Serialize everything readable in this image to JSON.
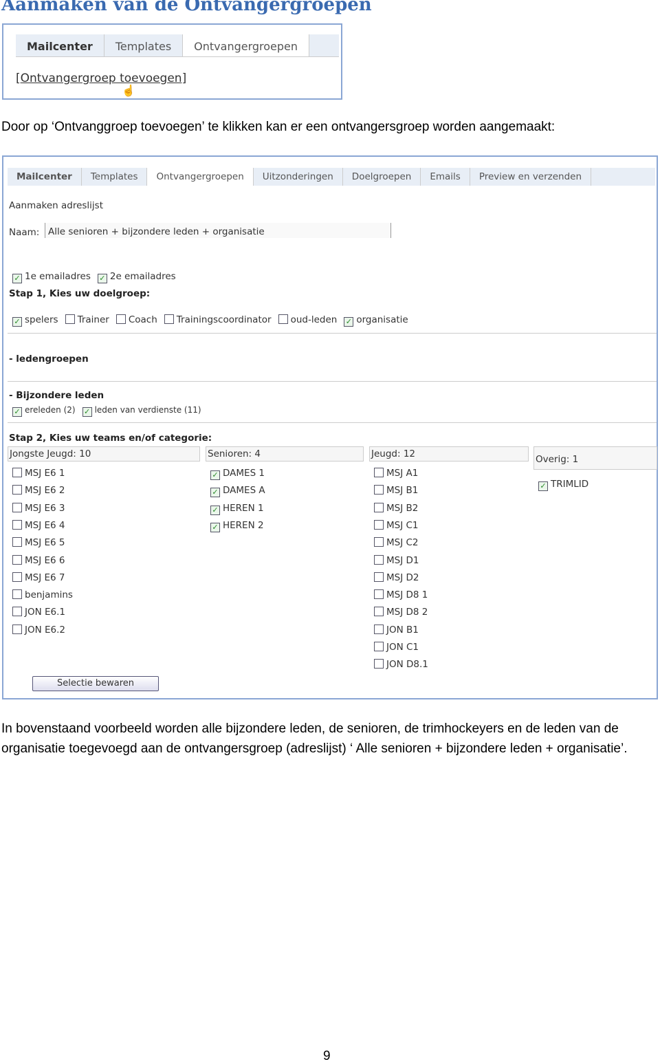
{
  "heading": "Aanmaken van de Ontvangergroepen",
  "shot1": {
    "tabs": [
      "Mailcenter",
      "Templates",
      "Ontvangergroepen"
    ],
    "link": "[Ontvangergroep toevoegen]"
  },
  "intro": "Door op ‘Ontvanggroep toevoegen’ te klikken kan er een ontvangersgroep worden aangemaakt:",
  "shot2": {
    "tabs": [
      "Mailcenter",
      "Templates",
      "Ontvangergroepen",
      "Uitzonderingen",
      "Doelgroepen",
      "Emails",
      "Preview en verzenden"
    ],
    "section_title": "Aanmaken adreslijst",
    "name_label": "Naam:",
    "name_value": "Alle senioren + bijzondere leden + organisatie",
    "email_options": [
      {
        "label": "1e emailadres",
        "checked": true
      },
      {
        "label": "2e emailadres",
        "checked": true
      }
    ],
    "step1": "Stap 1, Kies uw doelgroep:",
    "doelgroepen": [
      {
        "label": "spelers",
        "checked": true
      },
      {
        "label": "Trainer",
        "checked": false
      },
      {
        "label": "Coach",
        "checked": false
      },
      {
        "label": "Trainingscoordinator",
        "checked": false
      },
      {
        "label": "oud-leden",
        "checked": false
      },
      {
        "label": "organisatie",
        "checked": true
      }
    ],
    "ledengroepen": "- ledengroepen",
    "bijzondere": "- Bijzondere leden",
    "bijzondere_items": [
      {
        "label": "ereleden (2)",
        "checked": true
      },
      {
        "label": "leden van verdienste (11)",
        "checked": true
      }
    ],
    "step2": "Stap 2, Kies uw teams en/of categorie:",
    "columns": [
      {
        "title": "Jongste Jeugd: 10",
        "items": [
          [
            "MSJ E6 1",
            false
          ],
          [
            "MSJ E6 2",
            false
          ],
          [
            "MSJ E6 3",
            false
          ],
          [
            "MSJ E6 4",
            false
          ],
          [
            "MSJ E6 5",
            false
          ],
          [
            "MSJ E6 6",
            false
          ],
          [
            "MSJ E6 7",
            false
          ],
          [
            "benjamins",
            false
          ],
          [
            "JON E6.1",
            false
          ],
          [
            "JON E6.2",
            false
          ]
        ]
      },
      {
        "title": "Senioren: 4",
        "items": [
          [
            "DAMES 1",
            true
          ],
          [
            "DAMES A",
            true
          ],
          [
            "HEREN 1",
            true
          ],
          [
            "HEREN 2",
            true
          ]
        ]
      },
      {
        "title": "Jeugd: 12",
        "items": [
          [
            "MSJ A1",
            false
          ],
          [
            "MSJ B1",
            false
          ],
          [
            "MSJ B2",
            false
          ],
          [
            "MSJ C1",
            false
          ],
          [
            "MSJ C2",
            false
          ],
          [
            "MSJ D1",
            false
          ],
          [
            "MSJ D2",
            false
          ],
          [
            "MSJ D8 1",
            false
          ],
          [
            "MSJ D8 2",
            false
          ],
          [
            "JON B1",
            false
          ],
          [
            "JON C1",
            false
          ],
          [
            "JON D8.1",
            false
          ]
        ]
      },
      {
        "title": "Overig: 1",
        "items": [
          [
            "TRIMLID",
            true
          ]
        ]
      }
    ],
    "save_button": "Selectie bewaren"
  },
  "outro": "In bovenstaand voorbeeld worden alle bijzondere leden, de senioren, de trimhockeyers en de leden van de organisatie toegevoegd aan de ontvangersgroep (adreslijst) ‘ Alle senioren + bijzondere leden + organisatie’.",
  "page_number": "9"
}
